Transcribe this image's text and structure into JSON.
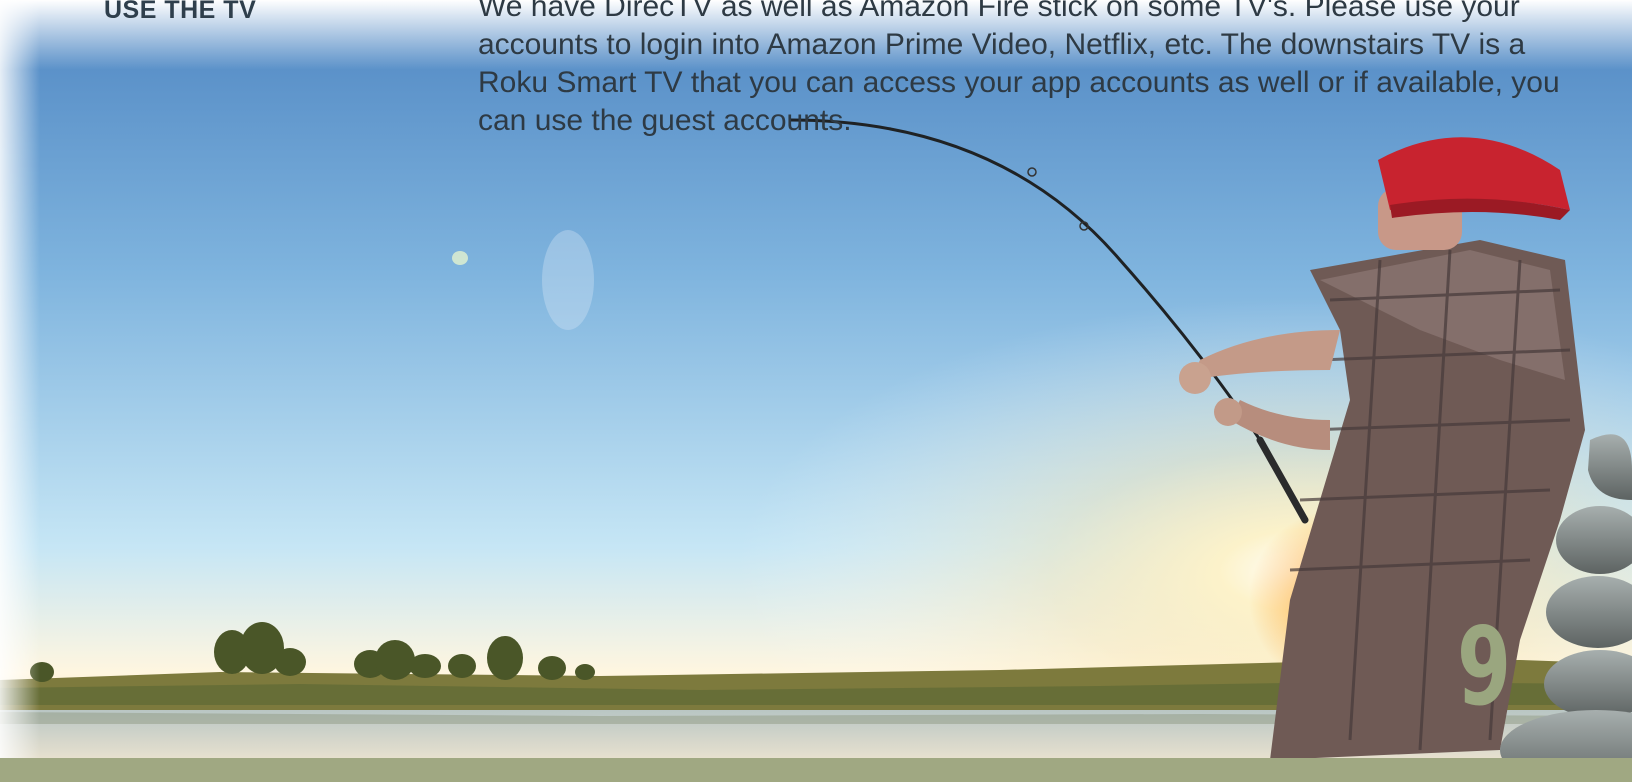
{
  "section": {
    "heading": "USE THE TV",
    "body": "We have DirecTV as well as Amazon Fire stick on some TV's. Please use your accounts to login into Amazon Prime Video, Netflix, etc.  The downstairs TV is a Roku Smart TV that you can access your app accounts as well or if available, you can use the guest accounts."
  },
  "page_number": "9",
  "colors": {
    "heading_text": "#2f3f4c",
    "body_text": "#2e3a44",
    "page_number": "#9aa67f",
    "footer_band": "#a0a882",
    "sky_top": "#4f86c2",
    "sky_mid": "#a9d6ee",
    "sun_glow": "#fff3c8"
  }
}
